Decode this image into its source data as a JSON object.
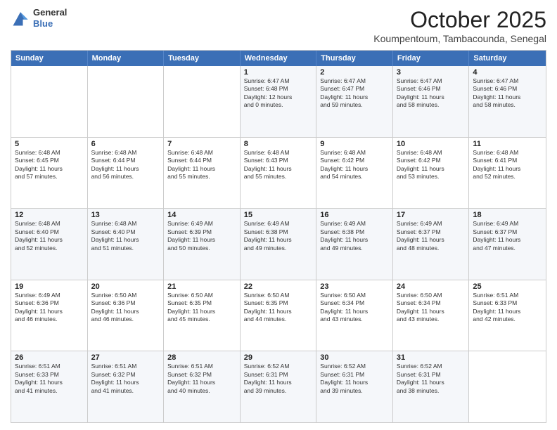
{
  "header": {
    "logo": {
      "general": "General",
      "blue": "Blue"
    },
    "title": "October 2025",
    "location": "Koumpentoum, Tambacounda, Senegal"
  },
  "calendar": {
    "day_headers": [
      "Sunday",
      "Monday",
      "Tuesday",
      "Wednesday",
      "Thursday",
      "Friday",
      "Saturday"
    ],
    "weeks": [
      [
        {
          "day": "",
          "info": ""
        },
        {
          "day": "",
          "info": ""
        },
        {
          "day": "",
          "info": ""
        },
        {
          "day": "1",
          "info": "Sunrise: 6:47 AM\nSunset: 6:48 PM\nDaylight: 12 hours\nand 0 minutes."
        },
        {
          "day": "2",
          "info": "Sunrise: 6:47 AM\nSunset: 6:47 PM\nDaylight: 11 hours\nand 59 minutes."
        },
        {
          "day": "3",
          "info": "Sunrise: 6:47 AM\nSunset: 6:46 PM\nDaylight: 11 hours\nand 58 minutes."
        },
        {
          "day": "4",
          "info": "Sunrise: 6:47 AM\nSunset: 6:46 PM\nDaylight: 11 hours\nand 58 minutes."
        }
      ],
      [
        {
          "day": "5",
          "info": "Sunrise: 6:48 AM\nSunset: 6:45 PM\nDaylight: 11 hours\nand 57 minutes."
        },
        {
          "day": "6",
          "info": "Sunrise: 6:48 AM\nSunset: 6:44 PM\nDaylight: 11 hours\nand 56 minutes."
        },
        {
          "day": "7",
          "info": "Sunrise: 6:48 AM\nSunset: 6:44 PM\nDaylight: 11 hours\nand 55 minutes."
        },
        {
          "day": "8",
          "info": "Sunrise: 6:48 AM\nSunset: 6:43 PM\nDaylight: 11 hours\nand 55 minutes."
        },
        {
          "day": "9",
          "info": "Sunrise: 6:48 AM\nSunset: 6:42 PM\nDaylight: 11 hours\nand 54 minutes."
        },
        {
          "day": "10",
          "info": "Sunrise: 6:48 AM\nSunset: 6:42 PM\nDaylight: 11 hours\nand 53 minutes."
        },
        {
          "day": "11",
          "info": "Sunrise: 6:48 AM\nSunset: 6:41 PM\nDaylight: 11 hours\nand 52 minutes."
        }
      ],
      [
        {
          "day": "12",
          "info": "Sunrise: 6:48 AM\nSunset: 6:40 PM\nDaylight: 11 hours\nand 52 minutes."
        },
        {
          "day": "13",
          "info": "Sunrise: 6:48 AM\nSunset: 6:40 PM\nDaylight: 11 hours\nand 51 minutes."
        },
        {
          "day": "14",
          "info": "Sunrise: 6:49 AM\nSunset: 6:39 PM\nDaylight: 11 hours\nand 50 minutes."
        },
        {
          "day": "15",
          "info": "Sunrise: 6:49 AM\nSunset: 6:38 PM\nDaylight: 11 hours\nand 49 minutes."
        },
        {
          "day": "16",
          "info": "Sunrise: 6:49 AM\nSunset: 6:38 PM\nDaylight: 11 hours\nand 49 minutes."
        },
        {
          "day": "17",
          "info": "Sunrise: 6:49 AM\nSunset: 6:37 PM\nDaylight: 11 hours\nand 48 minutes."
        },
        {
          "day": "18",
          "info": "Sunrise: 6:49 AM\nSunset: 6:37 PM\nDaylight: 11 hours\nand 47 minutes."
        }
      ],
      [
        {
          "day": "19",
          "info": "Sunrise: 6:49 AM\nSunset: 6:36 PM\nDaylight: 11 hours\nand 46 minutes."
        },
        {
          "day": "20",
          "info": "Sunrise: 6:50 AM\nSunset: 6:36 PM\nDaylight: 11 hours\nand 46 minutes."
        },
        {
          "day": "21",
          "info": "Sunrise: 6:50 AM\nSunset: 6:35 PM\nDaylight: 11 hours\nand 45 minutes."
        },
        {
          "day": "22",
          "info": "Sunrise: 6:50 AM\nSunset: 6:35 PM\nDaylight: 11 hours\nand 44 minutes."
        },
        {
          "day": "23",
          "info": "Sunrise: 6:50 AM\nSunset: 6:34 PM\nDaylight: 11 hours\nand 43 minutes."
        },
        {
          "day": "24",
          "info": "Sunrise: 6:50 AM\nSunset: 6:34 PM\nDaylight: 11 hours\nand 43 minutes."
        },
        {
          "day": "25",
          "info": "Sunrise: 6:51 AM\nSunset: 6:33 PM\nDaylight: 11 hours\nand 42 minutes."
        }
      ],
      [
        {
          "day": "26",
          "info": "Sunrise: 6:51 AM\nSunset: 6:33 PM\nDaylight: 11 hours\nand 41 minutes."
        },
        {
          "day": "27",
          "info": "Sunrise: 6:51 AM\nSunset: 6:32 PM\nDaylight: 11 hours\nand 41 minutes."
        },
        {
          "day": "28",
          "info": "Sunrise: 6:51 AM\nSunset: 6:32 PM\nDaylight: 11 hours\nand 40 minutes."
        },
        {
          "day": "29",
          "info": "Sunrise: 6:52 AM\nSunset: 6:31 PM\nDaylight: 11 hours\nand 39 minutes."
        },
        {
          "day": "30",
          "info": "Sunrise: 6:52 AM\nSunset: 6:31 PM\nDaylight: 11 hours\nand 39 minutes."
        },
        {
          "day": "31",
          "info": "Sunrise: 6:52 AM\nSunset: 6:31 PM\nDaylight: 11 hours\nand 38 minutes."
        },
        {
          "day": "",
          "info": ""
        }
      ]
    ]
  }
}
